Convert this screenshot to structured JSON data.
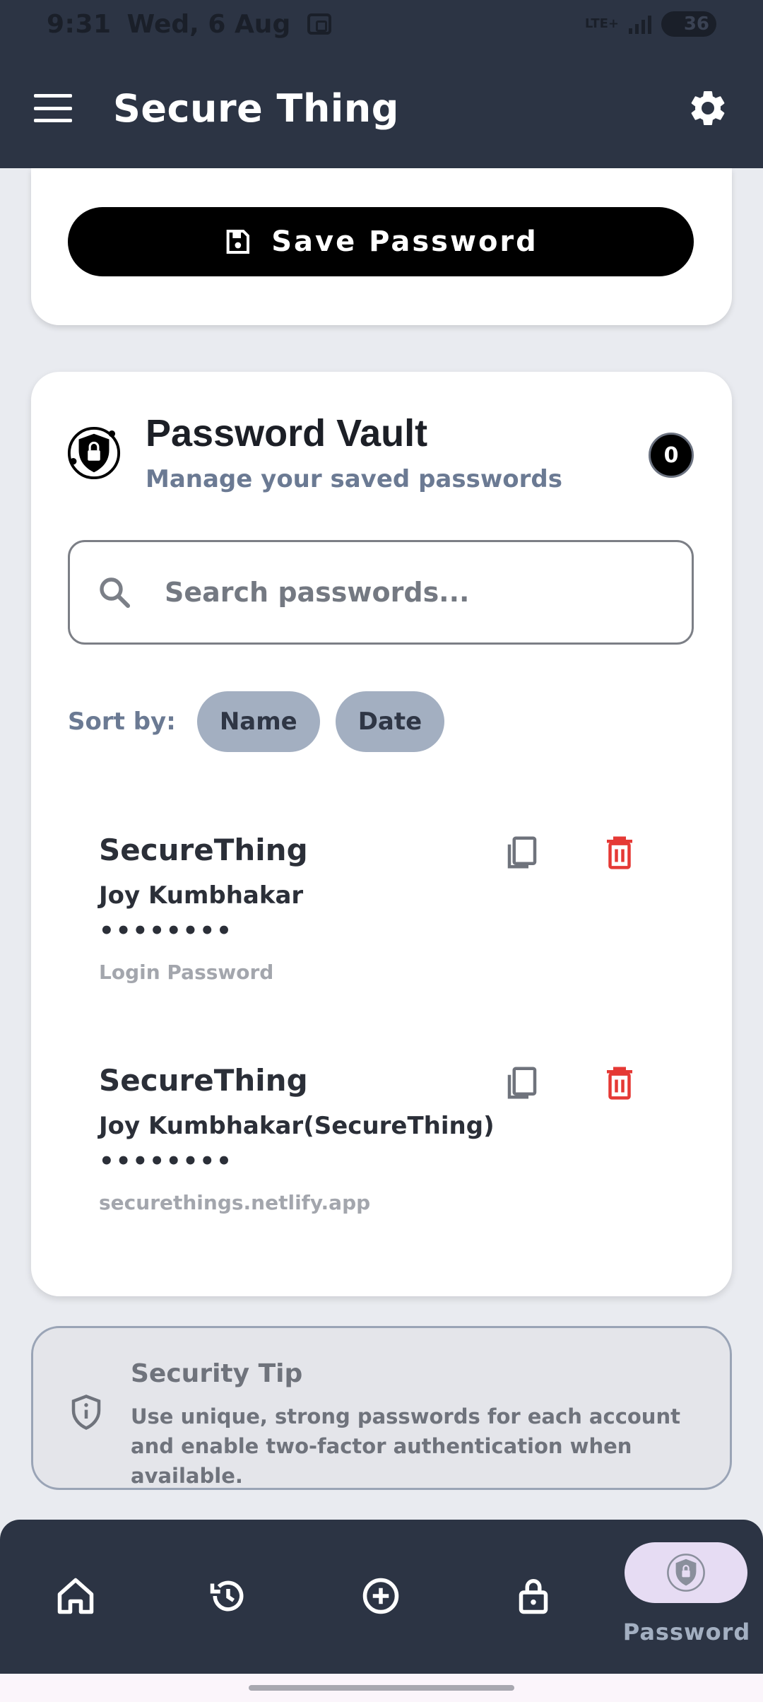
{
  "status_bar": {
    "time": "9:31",
    "date": "Wed, 6 Aug",
    "network": "LTE+",
    "battery": "36"
  },
  "app_bar": {
    "title": "Secure Thing"
  },
  "save": {
    "label": "Save Password"
  },
  "vault": {
    "title": "Password Vault",
    "subtitle": "Manage your saved passwords",
    "count": "0",
    "search_placeholder": "Search passwords...",
    "sort_label": "Sort by:",
    "sort_options": [
      "Name",
      "Date"
    ],
    "entries": [
      {
        "title": "SecureThing",
        "username": "Joy Kumbhakar",
        "password": "••••••••",
        "note": "Login Password"
      },
      {
        "title": "SecureThing",
        "username": "Joy Kumbhakar(SecureThing)",
        "password": "••••••••",
        "note": "securethings.netlify.app"
      }
    ]
  },
  "tip": {
    "title": "Security Tip",
    "text": "Use unique, strong passwords for each account and enable two-factor authentication when available."
  },
  "bottom_nav": {
    "items": [
      "home-icon",
      "history-icon",
      "add-circle-icon",
      "lock-icon",
      "password-shield-icon"
    ],
    "active_label": "Password"
  },
  "colors": {
    "appbar": "#2c3444",
    "delete": "#e53935",
    "chip": "#a3afc1",
    "accent_pill": "#e6dcf3"
  }
}
